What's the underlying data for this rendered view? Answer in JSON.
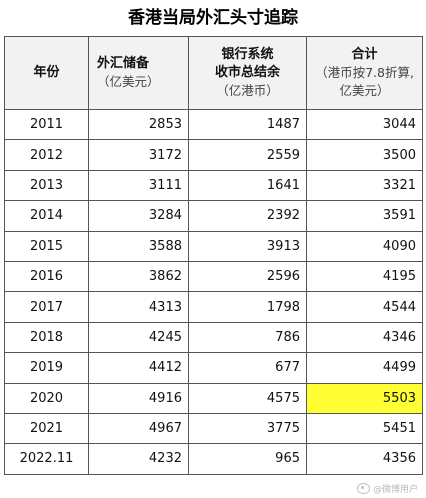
{
  "title": "香港当局外汇头寸追踪",
  "headers": {
    "year": {
      "main": "年份"
    },
    "fx": {
      "main": "外汇储备",
      "sub": "（亿美元）"
    },
    "bank": {
      "main1": "银行系统",
      "main2": "收市总结余",
      "sub": "（亿港币）"
    },
    "total": {
      "main": "合计",
      "sub1": "（港币按7.8折算,",
      "sub2": "亿美元）"
    }
  },
  "rows": [
    {
      "year": "2011",
      "fx": "2853",
      "bank": "1487",
      "total": "3044"
    },
    {
      "year": "2012",
      "fx": "3172",
      "bank": "2559",
      "total": "3500"
    },
    {
      "year": "2013",
      "fx": "3111",
      "bank": "1641",
      "total": "3321"
    },
    {
      "year": "2014",
      "fx": "3284",
      "bank": "2392",
      "total": "3591"
    },
    {
      "year": "2015",
      "fx": "3588",
      "bank": "3913",
      "total": "4090"
    },
    {
      "year": "2016",
      "fx": "3862",
      "bank": "2596",
      "total": "4195"
    },
    {
      "year": "2017",
      "fx": "4313",
      "bank": "1798",
      "total": "4544"
    },
    {
      "year": "2018",
      "fx": "4245",
      "bank": "786",
      "total": "4346"
    },
    {
      "year": "2019",
      "fx": "4412",
      "bank": "677",
      "total": "4499"
    },
    {
      "year": "2020",
      "fx": "4916",
      "bank": "4575",
      "total": "5503"
    },
    {
      "year": "2021",
      "fx": "4967",
      "bank": "3775",
      "total": "5451"
    },
    {
      "year": "2022.11",
      "fx": "4232",
      "bank": "965",
      "total": "4356"
    }
  ],
  "highlight_color": "#ffff33",
  "highlighted_row": 9,
  "watermark": "@微博用户"
}
